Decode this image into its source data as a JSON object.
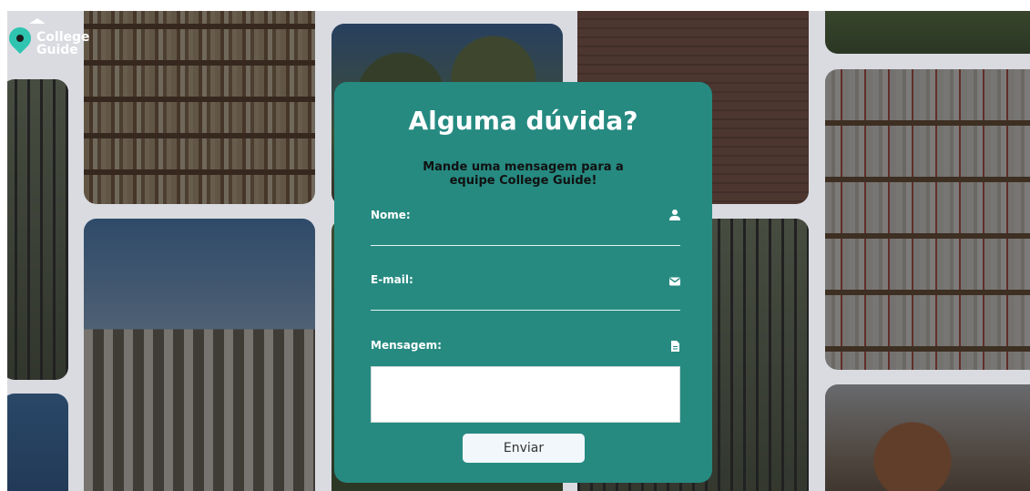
{
  "logo": {
    "line1": "College",
    "line2": "Guide"
  },
  "contact": {
    "title": "Alguma dúvida?",
    "subtitle_line1": "Mande uma mensagem para a",
    "subtitle_line2": "equipe College Guide!",
    "name_label": "Nome:",
    "email_label": "E-mail:",
    "message_label": "Mensagem:",
    "name_value": "",
    "email_value": "",
    "message_value": "",
    "submit_label": "Enviar"
  },
  "icons": {
    "name": "user-icon",
    "email": "envelope-icon",
    "message": "document-icon"
  },
  "colors": {
    "card": "#268a81",
    "logo_pin": "#2ec4b0",
    "button": "#f1f7fb"
  }
}
